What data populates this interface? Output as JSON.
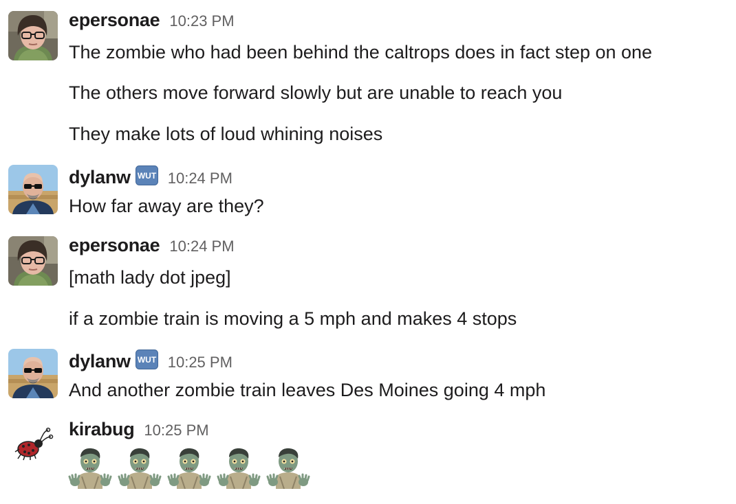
{
  "messages": [
    {
      "user": "epersonae",
      "time": "10:23 PM",
      "avatar": "woman-with-glasses-avatar",
      "lines": [
        "The zombie who had been behind the caltrops does in fact step on one",
        "The others move forward slowly but are unable to reach you",
        "They make lots of loud whining noises"
      ]
    },
    {
      "user": "dylanw",
      "status_badge": "WUT",
      "time": "10:24 PM",
      "avatar": "bald-man-sunglasses-avatar",
      "lines": [
        "How far away are they?"
      ]
    },
    {
      "user": "epersonae",
      "time": "10:24 PM",
      "avatar": "woman-with-glasses-avatar",
      "lines": [
        "[math lady dot jpeg]",
        "if a zombie train is moving a 5 mph and makes 4 stops"
      ]
    },
    {
      "user": "dylanw",
      "status_badge": "WUT",
      "time": "10:25 PM",
      "avatar": "bald-man-sunglasses-avatar",
      "lines": [
        "And another zombie train leaves Des Moines going 4 mph"
      ]
    },
    {
      "user": "kirabug",
      "time": "10:25 PM",
      "avatar": "ladybug-avatar",
      "emoji_count": 5,
      "emoji": "zombie-emoji"
    }
  ],
  "colors": {
    "text": "#1d1c1d",
    "timestamp": "#616061",
    "badge_bg": "#5b83b8"
  }
}
